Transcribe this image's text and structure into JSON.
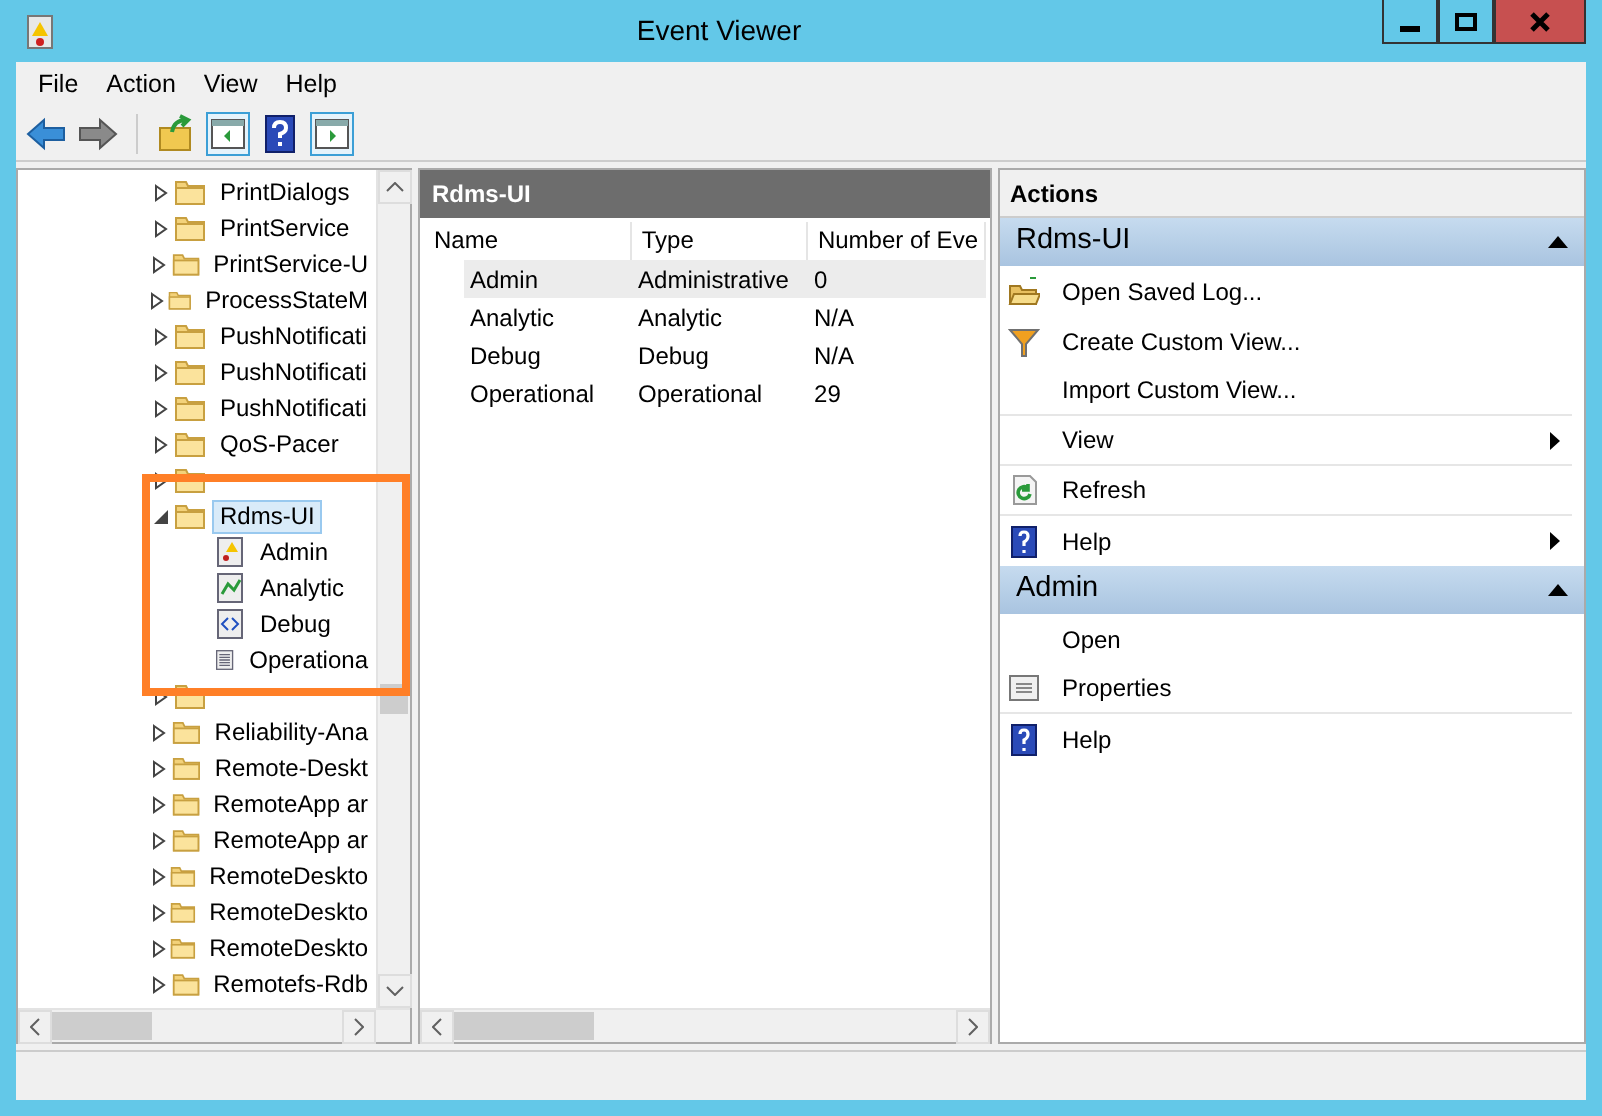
{
  "window": {
    "title": "Event Viewer"
  },
  "menu": [
    "File",
    "Action",
    "View",
    "Help"
  ],
  "toolbar": [
    {
      "kind": "back",
      "selected": false
    },
    {
      "kind": "forward",
      "selected": false
    },
    {
      "kind": "up",
      "selected": false
    },
    {
      "kind": "pane-left",
      "selected": true
    },
    {
      "kind": "help",
      "selected": false
    },
    {
      "kind": "pane-right",
      "selected": true
    }
  ],
  "tree": [
    {
      "label": "PrintDialogs",
      "expanded": false,
      "selected": false
    },
    {
      "label": "PrintService",
      "expanded": false,
      "selected": false
    },
    {
      "label": "PrintService-U",
      "expanded": false,
      "selected": false
    },
    {
      "label": "ProcessStateM",
      "expanded": false,
      "selected": false
    },
    {
      "label": "PushNotificati",
      "expanded": false,
      "selected": false
    },
    {
      "label": "PushNotificati",
      "expanded": false,
      "selected": false
    },
    {
      "label": "PushNotificati",
      "expanded": false,
      "selected": false
    },
    {
      "label": "QoS-Pacer",
      "expanded": false,
      "selected": false
    },
    {
      "expanded": false,
      "selected": false
    },
    {
      "label": "Rdms-UI",
      "expanded": true,
      "selected": true,
      "children": [
        {
          "label": "Admin",
          "kind": "admin"
        },
        {
          "label": "Analytic",
          "kind": "analytic"
        },
        {
          "label": "Debug",
          "kind": "debug"
        },
        {
          "label": "Operationa",
          "kind": "log"
        }
      ]
    },
    {
      "expanded": false,
      "selected": false
    },
    {
      "label": "Reliability-Ana",
      "expanded": false,
      "selected": false
    },
    {
      "label": "Remote-Deskt",
      "expanded": false,
      "selected": false
    },
    {
      "label": "RemoteApp ar",
      "expanded": false,
      "selected": false
    },
    {
      "label": "RemoteApp ar",
      "expanded": false,
      "selected": false
    },
    {
      "label": "RemoteDeskto",
      "expanded": false,
      "selected": false
    },
    {
      "label": "RemoteDeskto",
      "expanded": false,
      "selected": false
    },
    {
      "label": "RemoteDeskto",
      "expanded": false,
      "selected": false
    },
    {
      "label": "Remotefs-Rdb",
      "expanded": false,
      "selected": false
    }
  ],
  "center": {
    "title": "Rdms-UI",
    "columns": [
      "Name",
      "Type",
      "Number of Eve"
    ],
    "rows": [
      {
        "cells": [
          "Admin",
          "Administrative",
          "0"
        ],
        "selected": true
      },
      {
        "cells": [
          "Analytic",
          "Analytic",
          "N/A"
        ],
        "selected": false
      },
      {
        "cells": [
          "Debug",
          "Debug",
          "N/A"
        ],
        "selected": false
      },
      {
        "cells": [
          "Operational",
          "Operational",
          "29"
        ],
        "selected": false
      }
    ]
  },
  "actions": {
    "title": "Actions",
    "sections": [
      {
        "title": "Rdms-UI",
        "expanded": true,
        "items": [
          {
            "label": "Open Saved Log...",
            "kind": "folder",
            "submenu": false,
            "divider_after": false
          },
          {
            "label": "Create Custom View...",
            "kind": "filter",
            "submenu": false,
            "divider_after": false
          },
          {
            "label": "Import Custom View...",
            "kind": "plain",
            "submenu": false,
            "divider_after": true
          },
          {
            "label": "View",
            "kind": "plain",
            "submenu": true,
            "divider_after": true
          },
          {
            "label": "Refresh",
            "kind": "refresh",
            "submenu": false,
            "divider_after": true
          },
          {
            "label": "Help",
            "kind": "help",
            "submenu": true,
            "divider_after": false
          }
        ]
      },
      {
        "title": "Admin",
        "expanded": true,
        "items": [
          {
            "label": "Open",
            "kind": "plain",
            "submenu": false,
            "divider_after": false
          },
          {
            "label": "Properties",
            "kind": "properties",
            "submenu": false,
            "divider_after": true
          },
          {
            "label": "Help",
            "kind": "help",
            "submenu": false,
            "divider_after": false
          }
        ]
      }
    ]
  }
}
